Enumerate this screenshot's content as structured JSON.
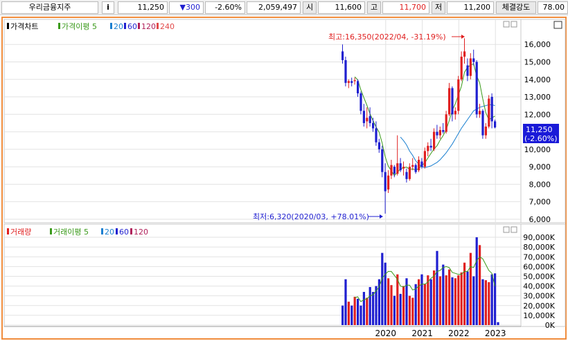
{
  "topbar": {
    "stock_name": "우리금융지주",
    "info_label": "i",
    "price": "11,250",
    "change": "▼300",
    "change_pct": "-2.60%",
    "volume": "2,059,497",
    "open_label": "시",
    "open": "11,600",
    "high_label": "고",
    "high": "11,700",
    "low_label": "저",
    "low": "11,200",
    "strength_label": "체결강도",
    "strength": "78.00"
  },
  "colors": {
    "up": "#e02020",
    "down": "#1f1fd0",
    "ma5": "#3a9a1a",
    "ma20": "#1a7fd0",
    "ma60": "#1f1fd0",
    "ma120": "#b0205a",
    "ma240": "#e24a4a",
    "frame": "#f08c3c",
    "current_box": "#1a1ad8"
  },
  "chart_data": [
    {
      "type": "candlestick",
      "legend": [
        {
          "label": "가격차트",
          "color": "#000000"
        },
        {
          "label": "가격이평 5",
          "color": "#3a9a1a"
        },
        {
          "label": "20",
          "color": "#1a7fd0"
        },
        {
          "label": "60",
          "color": "#1f1fd0"
        },
        {
          "label": "120",
          "color": "#b0205a"
        },
        {
          "label": "240",
          "color": "#e24a4a"
        }
      ],
      "y_ticks": [
        6000,
        7000,
        8000,
        9000,
        10000,
        11000,
        12000,
        13000,
        14000,
        15000,
        16000
      ],
      "y_tick_labels": [
        "6,000",
        "7,000",
        "8,000",
        "9,000",
        "10,000",
        "11,000",
        "12,000",
        "13,000",
        "14,000",
        "15,000",
        "16,000"
      ],
      "ylim": [
        5800,
        16800
      ],
      "current_price_label": "11,250",
      "current_change_label": "(-2.60%)",
      "high_annotation": "최고:16,350(2022/04, -31.19%)",
      "low_annotation": "최저:6,320(2020/03, +78.01%)",
      "candles": [
        {
          "o": 15600,
          "h": 16000,
          "l": 14900,
          "c": 15100
        },
        {
          "o": 15100,
          "h": 15300,
          "l": 13600,
          "c": 13800
        },
        {
          "o": 13800,
          "h": 14000,
          "l": 13500,
          "c": 13900
        },
        {
          "o": 13900,
          "h": 14100,
          "l": 13600,
          "c": 13800
        },
        {
          "o": 13900,
          "h": 14100,
          "l": 13700,
          "c": 13950
        },
        {
          "o": 13900,
          "h": 14000,
          "l": 13000,
          "c": 13200
        },
        {
          "o": 13200,
          "h": 13300,
          "l": 12000,
          "c": 12200
        },
        {
          "o": 12200,
          "h": 12600,
          "l": 11300,
          "c": 11500
        },
        {
          "o": 11600,
          "h": 12400,
          "l": 11200,
          "c": 11800
        },
        {
          "o": 11900,
          "h": 12400,
          "l": 11300,
          "c": 11500
        },
        {
          "o": 11500,
          "h": 11800,
          "l": 11000,
          "c": 11200
        },
        {
          "o": 11200,
          "h": 11600,
          "l": 10200,
          "c": 10400
        },
        {
          "o": 10400,
          "h": 10600,
          "l": 9800,
          "c": 10000
        },
        {
          "o": 10000,
          "h": 10200,
          "l": 8400,
          "c": 8700
        },
        {
          "o": 8700,
          "h": 9200,
          "l": 6320,
          "c": 7600
        },
        {
          "o": 7700,
          "h": 8800,
          "l": 7500,
          "c": 8500
        },
        {
          "o": 8500,
          "h": 9400,
          "l": 8300,
          "c": 9100
        },
        {
          "o": 9000,
          "h": 9100,
          "l": 8400,
          "c": 8600
        },
        {
          "o": 8600,
          "h": 10800,
          "l": 8500,
          "c": 9200
        },
        {
          "o": 9200,
          "h": 9500,
          "l": 8700,
          "c": 8800
        },
        {
          "o": 8900,
          "h": 9300,
          "l": 8500,
          "c": 9000
        },
        {
          "o": 8700,
          "h": 8900,
          "l": 8100,
          "c": 8300
        },
        {
          "o": 8300,
          "h": 9200,
          "l": 8200,
          "c": 9000
        },
        {
          "o": 9000,
          "h": 9500,
          "l": 8800,
          "c": 9100
        },
        {
          "o": 9100,
          "h": 9200,
          "l": 8600,
          "c": 8700
        },
        {
          "o": 8800,
          "h": 9600,
          "l": 8700,
          "c": 9400
        },
        {
          "o": 9300,
          "h": 9500,
          "l": 8900,
          "c": 9000
        },
        {
          "o": 9000,
          "h": 10100,
          "l": 8900,
          "c": 9900
        },
        {
          "o": 9900,
          "h": 10400,
          "l": 9600,
          "c": 10200
        },
        {
          "o": 10200,
          "h": 10600,
          "l": 9900,
          "c": 10100
        },
        {
          "o": 10000,
          "h": 11200,
          "l": 9900,
          "c": 11000
        },
        {
          "o": 11000,
          "h": 11400,
          "l": 10600,
          "c": 10800
        },
        {
          "o": 10800,
          "h": 11300,
          "l": 10600,
          "c": 11100
        },
        {
          "o": 11100,
          "h": 11500,
          "l": 10900,
          "c": 11000
        },
        {
          "o": 11000,
          "h": 12200,
          "l": 10900,
          "c": 12000
        },
        {
          "o": 12000,
          "h": 13800,
          "l": 11900,
          "c": 13500
        },
        {
          "o": 13500,
          "h": 13600,
          "l": 11600,
          "c": 12000
        },
        {
          "o": 12000,
          "h": 12400,
          "l": 11700,
          "c": 12200
        },
        {
          "o": 12200,
          "h": 14200,
          "l": 12000,
          "c": 14000
        },
        {
          "o": 14000,
          "h": 15600,
          "l": 13900,
          "c": 15300
        },
        {
          "o": 15300,
          "h": 16350,
          "l": 14900,
          "c": 15600
        },
        {
          "o": 14800,
          "h": 15200,
          "l": 13900,
          "c": 14200
        },
        {
          "o": 14200,
          "h": 15500,
          "l": 14000,
          "c": 15200
        },
        {
          "o": 15200,
          "h": 15700,
          "l": 14800,
          "c": 15000
        },
        {
          "o": 15000,
          "h": 15100,
          "l": 11800,
          "c": 12000
        },
        {
          "o": 12000,
          "h": 12600,
          "l": 11800,
          "c": 12200
        },
        {
          "o": 12200,
          "h": 12300,
          "l": 10600,
          "c": 10800
        },
        {
          "o": 10800,
          "h": 11500,
          "l": 10600,
          "c": 11300
        },
        {
          "o": 11300,
          "h": 13100,
          "l": 11200,
          "c": 12900
        },
        {
          "o": 13000,
          "h": 13200,
          "l": 11200,
          "c": 11600
        },
        {
          "o": 11600,
          "h": 11700,
          "l": 11200,
          "c": 11250
        }
      ],
      "ma5": [
        null,
        null,
        null,
        null,
        14150,
        13970,
        13410,
        12950,
        12520,
        12040,
        11640,
        11280,
        10980,
        10360,
        9580,
        9040,
        8780,
        8500,
        8680,
        8880,
        8940,
        8980,
        8860,
        8880,
        8820,
        8900,
        9080,
        9220,
        9500,
        9760,
        10020,
        10200,
        10520,
        10780,
        11120,
        11640,
        12220,
        12600,
        13100,
        13600,
        14400,
        14700,
        14800,
        14900,
        14200,
        13800,
        12900,
        12100,
        11700,
        11800,
        11900
      ],
      "ma20": [
        null,
        null,
        null,
        null,
        null,
        null,
        null,
        null,
        null,
        null,
        null,
        null,
        null,
        null,
        null,
        null,
        null,
        null,
        null,
        10700,
        10500,
        10250,
        9900,
        9650,
        9350,
        9150,
        9000,
        8950,
        9000,
        9050,
        9150,
        9250,
        9400,
        9600,
        9800,
        10050,
        10300,
        10600,
        10900,
        11200,
        11450,
        11700,
        11950,
        12200,
        12300,
        12400,
        12450,
        12500,
        12550,
        12550,
        12500
      ],
      "ma60": [],
      "ma120": [],
      "ma240": []
    },
    {
      "type": "bar",
      "legend": [
        {
          "label": "거래량",
          "color": "#e02020"
        },
        {
          "label": "거래이평 5",
          "color": "#3a9a1a"
        },
        {
          "label": "20",
          "color": "#1a7fd0"
        },
        {
          "label": "60",
          "color": "#1f1fd0"
        },
        {
          "label": "120",
          "color": "#b0205a"
        }
      ],
      "y_ticks": [
        0,
        10000,
        20000,
        30000,
        40000,
        50000,
        60000,
        70000,
        80000,
        90000
      ],
      "y_tick_labels": [
        "0K",
        "10,000K",
        "20,000K",
        "30,000K",
        "40,000K",
        "50,000K",
        "60,000K",
        "70,000K",
        "80,000K",
        "90,000K"
      ],
      "ylim": [
        0,
        95000
      ],
      "x_tick_labels": [
        "2020",
        "2021",
        "2022",
        "2023"
      ],
      "x_tick_index": [
        14.5,
        26.5,
        38.5,
        50.5
      ],
      "volumes": [
        20000,
        47000,
        24000,
        20000,
        29000,
        27000,
        20000,
        34000,
        28000,
        39000,
        34000,
        40000,
        47000,
        74000,
        64000,
        48000,
        41000,
        30000,
        52000,
        32000,
        40000,
        48000,
        30000,
        28000,
        42000,
        47000,
        52000,
        42000,
        51000,
        47000,
        56000,
        76000,
        50000,
        62000,
        51000,
        57000,
        49000,
        48000,
        51000,
        54000,
        64000,
        55000,
        74000,
        50000,
        90000,
        82000,
        47000,
        46000,
        44000,
        52000,
        53000,
        3000
      ],
      "vol_ma5": [
        null,
        null,
        null,
        null,
        28000,
        29000,
        24000,
        26000,
        27000,
        30000,
        31000,
        35000,
        39000,
        48000,
        52000,
        55000,
        55000,
        51000,
        47000,
        40000,
        39000,
        41000,
        41000,
        36000,
        37000,
        40000,
        42000,
        42000,
        44000,
        48000,
        50000,
        55000,
        56000,
        59000,
        60000,
        59000,
        54000,
        53000,
        52000,
        52000,
        55000,
        55000,
        60000,
        59000,
        66000,
        70000,
        68000,
        62000,
        56000,
        53000,
        40000
      ]
    }
  ]
}
